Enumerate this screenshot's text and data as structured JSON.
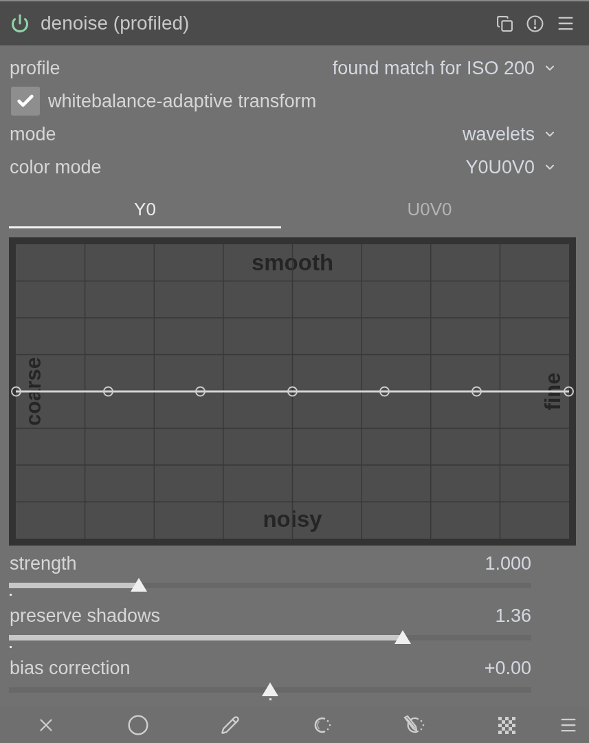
{
  "header": {
    "title": "denoise (profiled)",
    "enabled": true
  },
  "settings": [
    {
      "kind": "dropdown",
      "label": "profile",
      "value": "found match for ISO 200"
    },
    {
      "kind": "checkbox",
      "label": "whitebalance-adaptive transform",
      "checked": true
    },
    {
      "kind": "dropdown",
      "label": "mode",
      "value": "wavelets"
    },
    {
      "kind": "dropdown",
      "label": "color mode",
      "value": "Y0U0V0"
    }
  ],
  "tabs": [
    {
      "label": "Y0",
      "selected": true
    },
    {
      "label": "U0V0",
      "selected": false
    }
  ],
  "graph": {
    "top_label": "smooth",
    "bottom_label": "noisy",
    "left_label": "coarse",
    "right_label": "fine"
  },
  "sliders": [
    {
      "kind": "fill",
      "label": "strength",
      "value": "1.000",
      "level": 0.249
    },
    {
      "kind": "fill",
      "label": "preserve shadows",
      "value": "1.36",
      "level": 0.754
    },
    {
      "kind": "centered",
      "label": "bias correction",
      "value": "+0.00",
      "level": 0.5
    }
  ]
}
